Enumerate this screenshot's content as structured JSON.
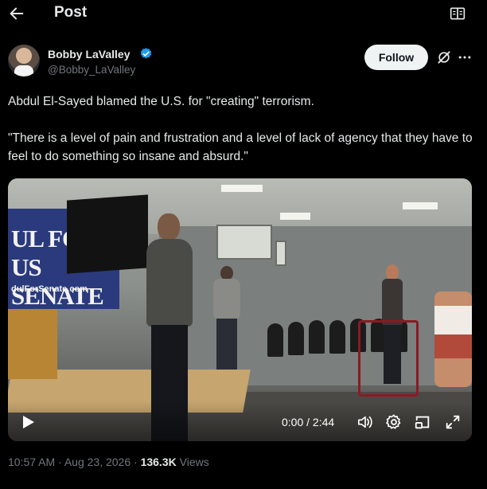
{
  "topbar": {
    "title": "Post",
    "back_icon": "arrow-left-icon",
    "reader_icon": "reader-mode-icon"
  },
  "author": {
    "name": "Bobby LaValley",
    "handle": "@Bobby_LaValley",
    "verified": true,
    "verified_color": "#1d9bf0"
  },
  "actions": {
    "follow_label": "Follow",
    "grok_icon": "grok-icon",
    "more_icon": "more-horizontal-icon"
  },
  "post": {
    "line1": "Abdul El-Sayed blamed the U.S. for \"creating\"  terrorism.",
    "line2": "\"There is a level of pain and frustration and a level of lack of agency that they have to feel to do something so insane and absurd.\""
  },
  "video": {
    "banner_big": "UL FOR US SENATE",
    "banner_small": "dulForSenate.com",
    "time": "0:00 / 2:44",
    "icons": [
      "play-icon",
      "volume-icon",
      "settings-icon",
      "picture-in-picture-icon",
      "fullscreen-icon"
    ]
  },
  "meta": {
    "time": "10:57 AM",
    "sep": " · ",
    "date": "Aug 23, 2026",
    "views_count": "136.3K",
    "views_label": "Views"
  },
  "colors": {
    "background": "#000000",
    "text": "#e7e9ea",
    "secondary": "#71767b",
    "follow_bg": "#eff3f4"
  }
}
